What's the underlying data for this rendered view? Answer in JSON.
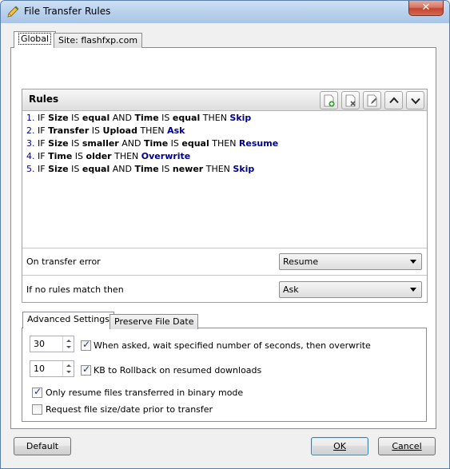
{
  "window": {
    "title": "File Transfer Rules",
    "close_label": "✕",
    "icon": "pencil-icon"
  },
  "tabs": [
    {
      "label": "Global",
      "active": true
    },
    {
      "label": "Site: flashfxp.com",
      "active": false
    }
  ],
  "rules": {
    "header": "Rules",
    "toolbar": [
      "add-rule-icon",
      "delete-rule-icon",
      "edit-rule-icon",
      "move-up-icon",
      "move-down-icon"
    ],
    "items": [
      {
        "num": "1.",
        "parts": [
          "IF ",
          "Size",
          " IS ",
          "equal",
          " AND ",
          "Time",
          " IS ",
          "equal",
          " THEN "
        ],
        "action": "Skip"
      },
      {
        "num": "2.",
        "parts": [
          "IF ",
          "Transfer",
          " IS ",
          "Upload",
          " THEN "
        ],
        "action": "Ask"
      },
      {
        "num": "3.",
        "parts": [
          "IF ",
          "Size",
          " IS ",
          "smaller",
          " AND ",
          "Time",
          " IS ",
          "equal",
          " THEN "
        ],
        "action": "Resume"
      },
      {
        "num": "4.",
        "parts": [
          "IF ",
          "Time",
          " IS ",
          "older",
          " THEN "
        ],
        "action": "Overwrite"
      },
      {
        "num": "5.",
        "parts": [
          "IF ",
          "Size",
          " IS ",
          "equal",
          " AND ",
          "Time",
          " IS ",
          "newer",
          " THEN "
        ],
        "action": "Skip"
      }
    ],
    "on_transfer_error": {
      "label": "On transfer error",
      "value": "Resume"
    },
    "no_rules_match": {
      "label": "If no rules match then",
      "value": "Ask"
    }
  },
  "bottom_tabs": [
    {
      "label": "Advanced Settings",
      "active": true
    },
    {
      "label": "Preserve File Date",
      "active": false
    }
  ],
  "advanced": {
    "wait_seconds": {
      "value": "30",
      "label": "When asked, wait specified number of seconds, then overwrite",
      "checked": true
    },
    "rollback": {
      "value": "10",
      "label": "KB to Rollback on resumed downloads",
      "checked": true
    },
    "binary_only": {
      "label": "Only resume files transferred in binary mode",
      "checked": true
    },
    "request_size": {
      "label": "Request file size/date prior to transfer",
      "checked": false
    }
  },
  "buttons": {
    "default_label": "Default",
    "ok_label": "OK",
    "cancel_label": "Cancel"
  }
}
